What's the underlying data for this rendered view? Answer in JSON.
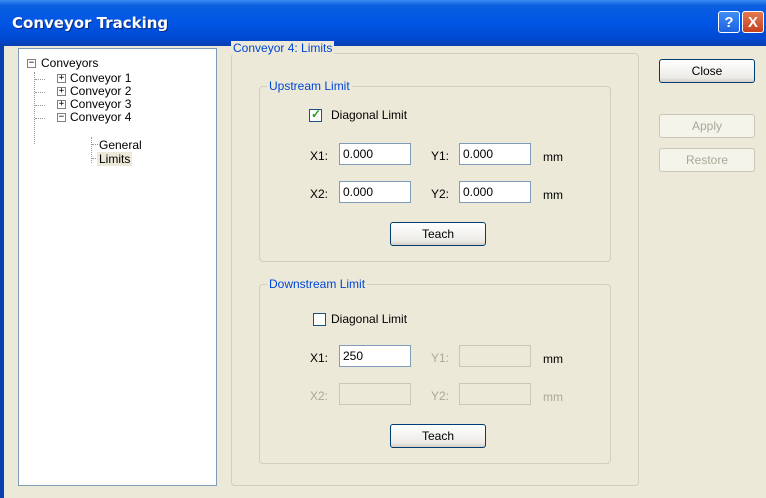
{
  "window": {
    "title": "Conveyor Tracking",
    "help_glyph": "?",
    "close_glyph": "X"
  },
  "tree": {
    "root": {
      "label": "Conveyors",
      "glyph": "−"
    },
    "items": [
      {
        "label": "Conveyor 1",
        "glyph": "+"
      },
      {
        "label": "Conveyor 2",
        "glyph": "+"
      },
      {
        "label": "Conveyor 3",
        "glyph": "+"
      },
      {
        "label": "Conveyor 4",
        "glyph": "−"
      }
    ],
    "children": [
      {
        "label": "General"
      },
      {
        "label": "Limits",
        "selected": true
      }
    ]
  },
  "panel": {
    "title": "Conveyor 4: Limits",
    "upstream": {
      "title": "Upstream Limit",
      "diagonal_label": "Diagonal Limit",
      "diagonal_checked": true,
      "check_glyph": "✓",
      "x1_label": "X1:",
      "x1_value": "0.000",
      "y1_label": "Y1:",
      "y1_value": "0.000",
      "x2_label": "X2:",
      "x2_value": "0.000",
      "y2_label": "Y2:",
      "y2_value": "0.000",
      "unit1": "mm",
      "unit2": "mm",
      "teach_label": "Teach"
    },
    "downstream": {
      "title": "Downstream Limit",
      "diagonal_label": "Diagonal Limit",
      "diagonal_checked": false,
      "x1_label": "X1:",
      "x1_value": "250",
      "y1_label": "Y1:",
      "y1_value": "",
      "x2_label": "X2:",
      "x2_value": "",
      "y2_label": "Y2:",
      "y2_value": "",
      "unit1": "mm",
      "unit2": "mm",
      "teach_label": "Teach"
    }
  },
  "buttons": {
    "close": "Close",
    "apply": "Apply",
    "restore": "Restore"
  },
  "colors": {
    "title_bar": "#0055e5",
    "group_label": "#0046d5",
    "disabled_text": "#aca899",
    "window_bg": "#ece9d8"
  }
}
